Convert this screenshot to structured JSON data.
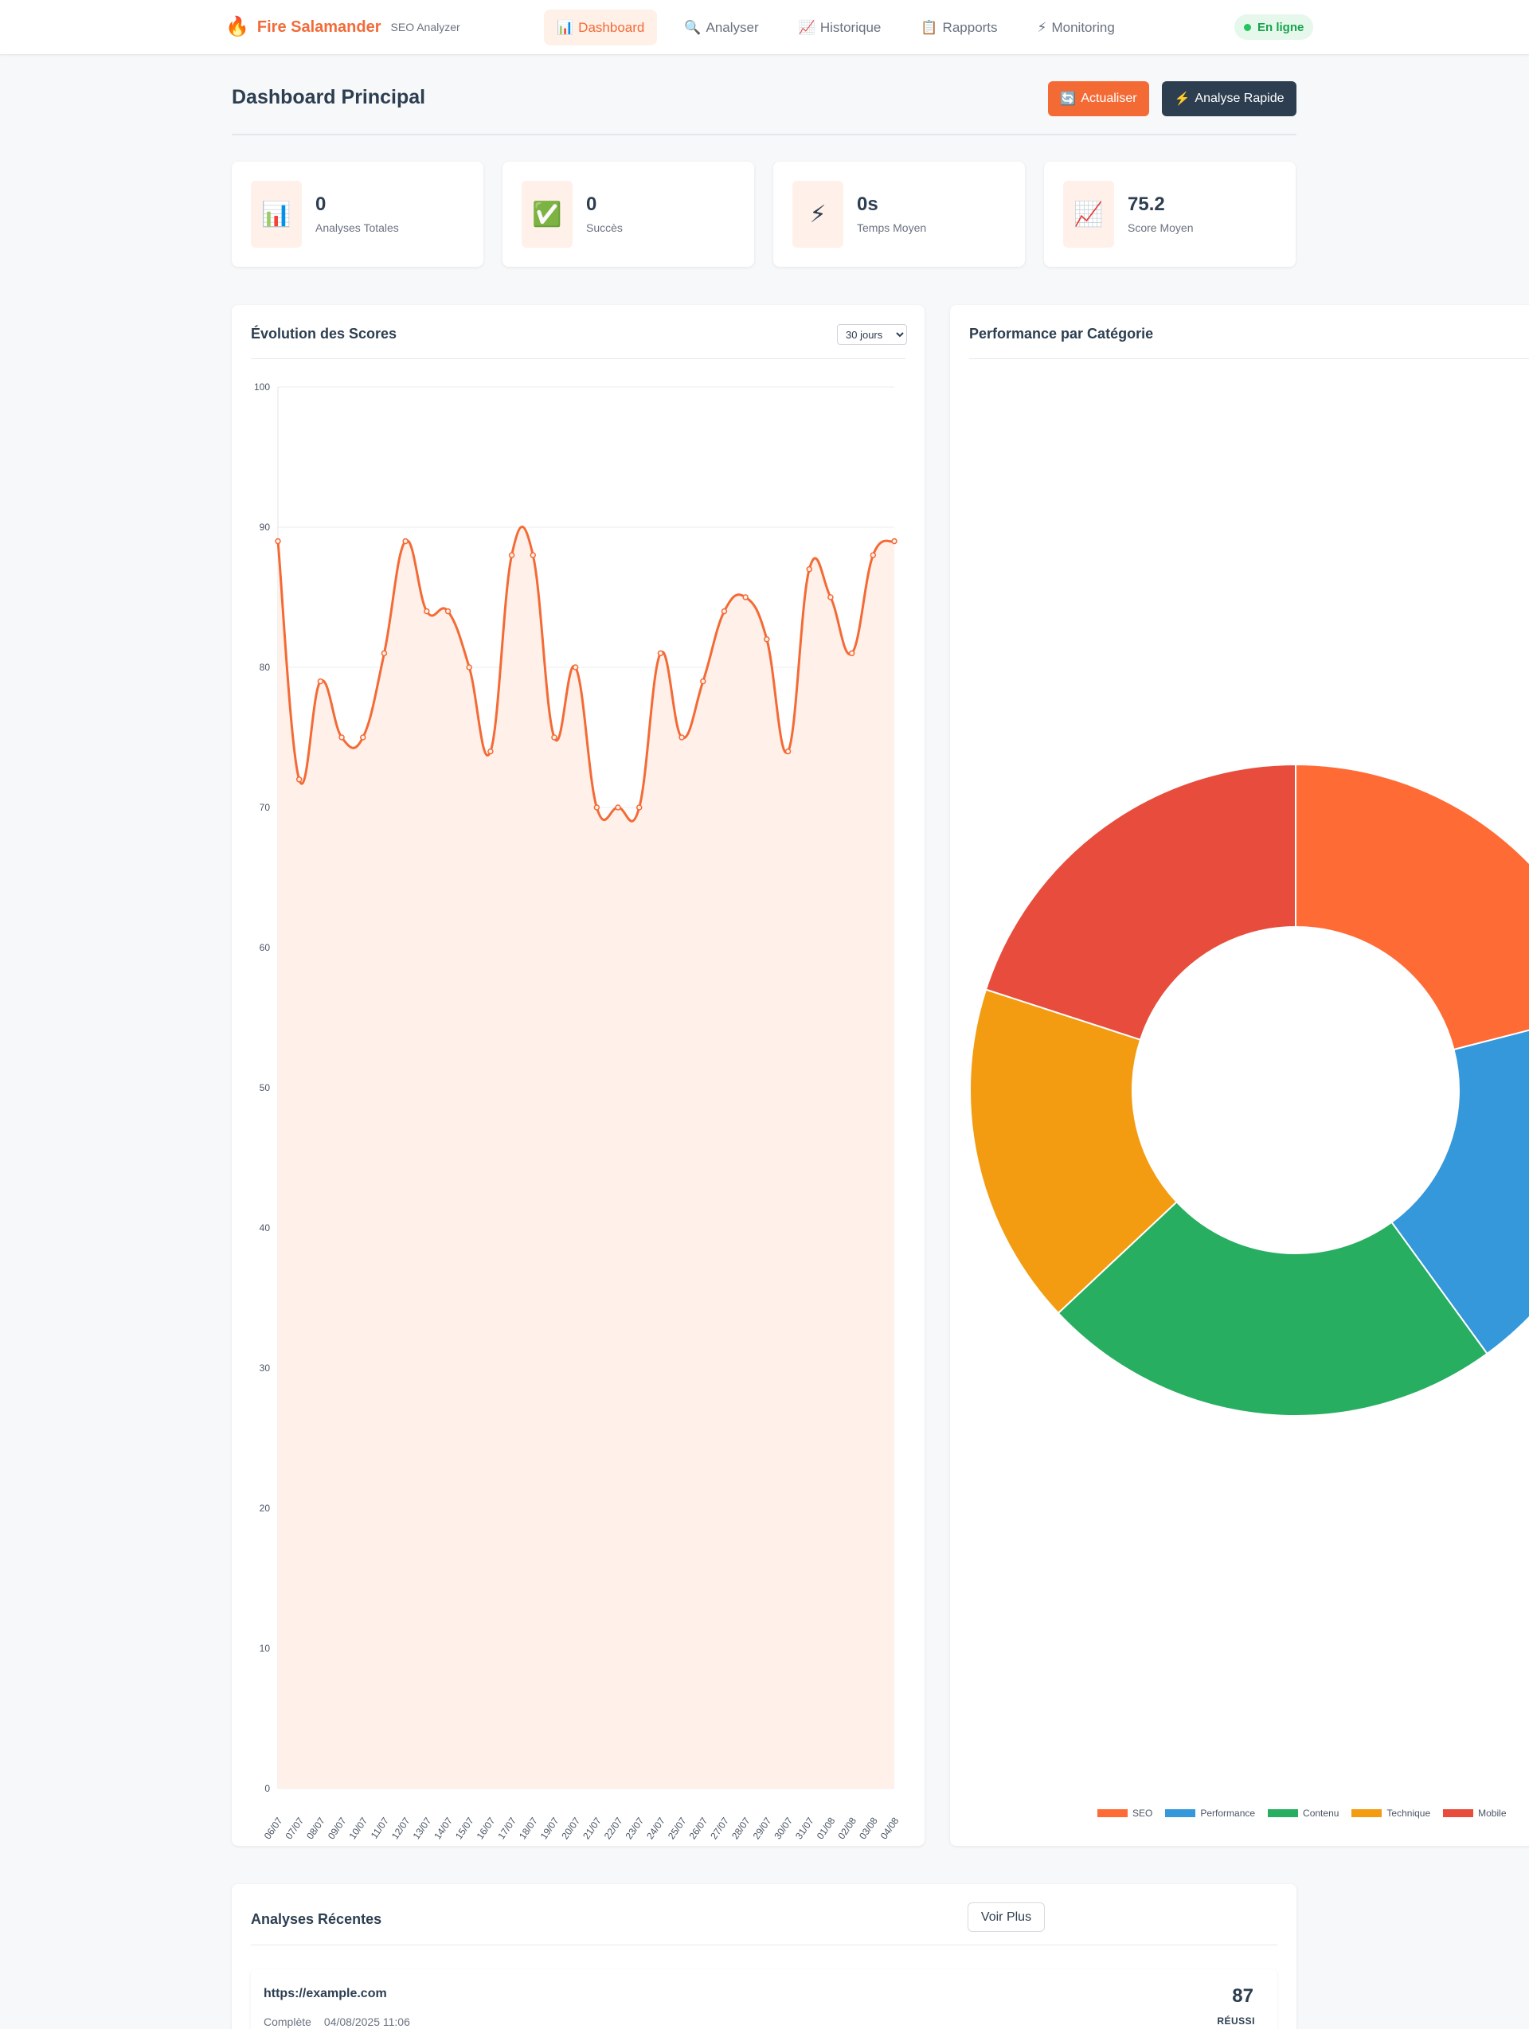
{
  "nav": {
    "brand_icon": "🔥",
    "brand_name": "Fire Salamander",
    "brand_sub": "SEO Analyzer",
    "items": [
      {
        "icon": "📊",
        "label": "Dashboard",
        "active": true
      },
      {
        "icon": "🔍",
        "label": "Analyser"
      },
      {
        "icon": "📈",
        "label": "Historique"
      },
      {
        "icon": "📋",
        "label": "Rapports"
      },
      {
        "icon": "⚡",
        "label": "Monitoring"
      }
    ],
    "status": "En ligne"
  },
  "header": {
    "title": "Dashboard Principal",
    "refresh_icon": "🔄",
    "refresh_label": "Actualiser",
    "quick_icon": "⚡",
    "quick_label": "Analyse Rapide"
  },
  "stats": [
    {
      "icon": "📊",
      "value": "0",
      "label": "Analyses Totales"
    },
    {
      "icon": "✅",
      "value": "0",
      "label": "Succès"
    },
    {
      "icon": "⚡",
      "value": "0s",
      "label": "Temps Moyen"
    },
    {
      "icon": "📈",
      "value": "75.2",
      "label": "Score Moyen"
    }
  ],
  "score_panel": {
    "title": "Évolution des Scores",
    "range_selected": "30 jours"
  },
  "category_panel": {
    "title": "Performance par Catégorie"
  },
  "colors": {
    "accent": "#f26b38",
    "dark": "#2c3e50",
    "line": "#f46a35",
    "fill": "#fff0ea"
  },
  "chart_data": [
    {
      "type": "line",
      "x": [
        "06/07",
        "07/07",
        "08/07",
        "09/07",
        "10/07",
        "11/07",
        "12/07",
        "13/07",
        "14/07",
        "15/07",
        "16/07",
        "17/07",
        "18/07",
        "19/07",
        "20/07",
        "21/07",
        "22/07",
        "23/07",
        "24/07",
        "25/07",
        "26/07",
        "27/07",
        "28/07",
        "29/07",
        "30/07",
        "31/07",
        "01/08",
        "02/08",
        "03/08",
        "04/08"
      ],
      "series": [
        {
          "values": [
            89,
            72,
            79,
            75,
            75,
            81,
            89,
            84,
            84,
            80,
            74,
            88,
            88,
            75,
            80,
            70,
            70,
            70,
            81,
            75,
            79,
            84,
            85,
            82,
            74,
            87,
            85,
            81,
            88,
            89
          ]
        }
      ],
      "ylim": [
        0,
        100
      ],
      "yticks": [
        0,
        10,
        20,
        30,
        40,
        50,
        60,
        70,
        80,
        90,
        100
      ],
      "fill": true,
      "grid": true
    },
    {
      "type": "pie",
      "donut": true,
      "categories": [
        "SEO",
        "Performance",
        "Contenu",
        "Technique",
        "Mobile"
      ],
      "values": [
        21,
        19,
        23,
        17,
        20
      ],
      "colors": [
        "#ff6b35",
        "#3498db",
        "#27ae60",
        "#f39c12",
        "#e74c3c"
      ],
      "legend": "bottom"
    }
  ],
  "recent": {
    "title": "Analyses Récentes",
    "more_label": "Voir Plus",
    "items": [
      {
        "url": "https://example.com",
        "status_text": "Complète",
        "date": "04/08/2025 11:06",
        "score": "87",
        "result": "RÉUSSI"
      }
    ]
  }
}
